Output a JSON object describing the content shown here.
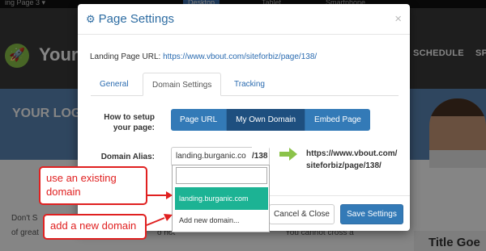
{
  "background_page": {
    "topbar": {
      "left_text": "ing Page 3 ▾",
      "view_desktop": "Desktop",
      "view_tablet": "Tablet",
      "view_smartphone": "Smartphone"
    },
    "brand": "Your",
    "nav": [
      "SCHEDULE",
      "SP"
    ],
    "banner_title": "YOUR LOG",
    "body_line1": "Don't S",
    "body_line2_left": "of great",
    "body_line2_mid": "o not",
    "body_line2_right": "You cannot cross a",
    "sidebar_title": "Title Goe"
  },
  "modal": {
    "title": "Page Settings",
    "close": "×",
    "landing_url_label": "Landing Page URL:",
    "landing_url": "https://www.vbout.com/siteforbiz/page/138/",
    "tabs": [
      {
        "label": "General",
        "active": false
      },
      {
        "label": "Domain Settings",
        "active": true
      },
      {
        "label": "Tracking",
        "active": false
      }
    ],
    "setup_label": "How to setup your page:",
    "setup_options": [
      {
        "label": "Page URL",
        "active": false
      },
      {
        "label": "My Own Domain",
        "active": true
      },
      {
        "label": "Embed Page",
        "active": false
      }
    ],
    "domain_alias_label": "Domain Alias:",
    "domain_alias_value": "landing.burganic.co",
    "domain_alias_suffix": "/138",
    "destination_url": "https://www.vbout.com/ siteforbiz/page/138/",
    "dropdown": {
      "search_value": "",
      "options": [
        "landing.burganic.com",
        "Add new domain..."
      ],
      "highlighted": "landing.burganic.com"
    },
    "cancel_label": "Cancel & Close",
    "save_label": "Save Settings"
  },
  "annotations": {
    "existing": "use an existing domain",
    "new": "add a new domain"
  },
  "colors": {
    "primary": "#337ab7",
    "primary_active": "#1e4f7f",
    "highlight": "#1cb394",
    "annotation": "#e02020",
    "arrow": "#8bc34a"
  }
}
